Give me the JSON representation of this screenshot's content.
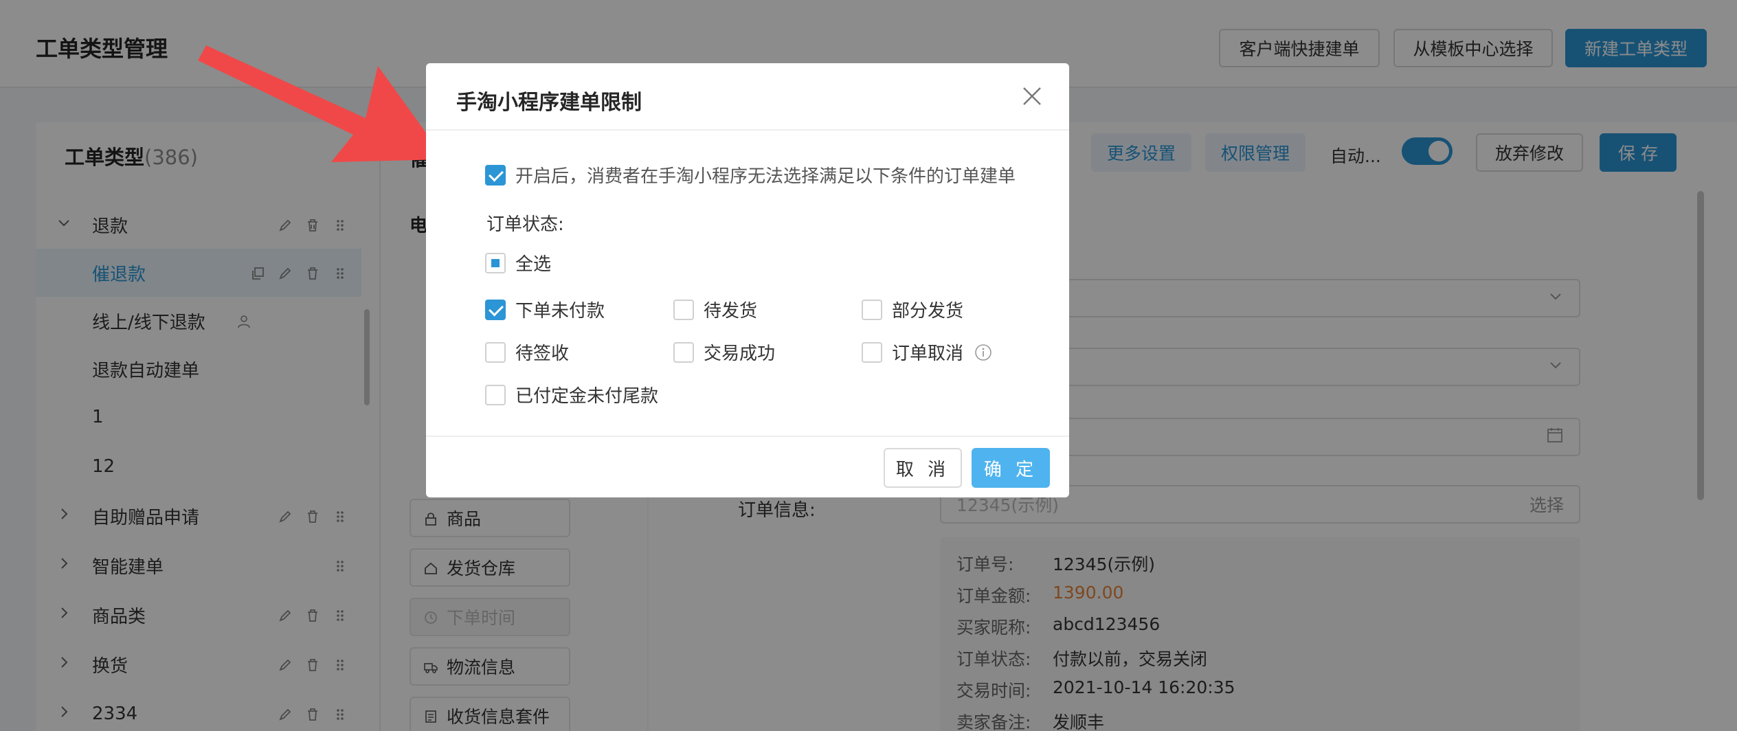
{
  "header": {
    "title": "工单类型管理",
    "buttons": [
      "客户端快捷建单",
      "从模板中心选择",
      "新建工单类型"
    ]
  },
  "sidebar": {
    "title": "工单类型",
    "count": "(386)",
    "items": [
      {
        "label": "退款",
        "expandable": true,
        "expanded": true
      },
      {
        "label": "催退款",
        "active": true
      },
      {
        "label": "线上/线下退款"
      },
      {
        "label": "退款自动建单"
      },
      {
        "label": "1"
      },
      {
        "label": "12"
      },
      {
        "label": "自助赠品申请",
        "expandable": true
      },
      {
        "label": "智能建单",
        "expandable": true
      },
      {
        "label": "商品类",
        "expandable": true
      },
      {
        "label": "换货",
        "expandable": true
      },
      {
        "label": "2334",
        "expandable": true
      }
    ]
  },
  "middle": {
    "title_partial": "催",
    "subtitle_partial": "电",
    "components": [
      {
        "label": "商品",
        "icon": "lock-icon"
      },
      {
        "label": "发货仓库",
        "icon": "home-icon"
      },
      {
        "label": "下单时间",
        "icon": "clock-icon",
        "disabled": true
      },
      {
        "label": "物流信息",
        "icon": "truck-icon"
      },
      {
        "label": "收货信息套件",
        "icon": "doc-icon"
      }
    ]
  },
  "toolbar": {
    "more_settings": "更多设置",
    "permissions": "权限管理",
    "auto_label": "自动...",
    "discard": "放弃修改",
    "save": "保 存"
  },
  "form": {
    "order_info_label": "订单信息:",
    "order_info_placeholder": "12345(示例)",
    "order_info_suffix": "选择",
    "card": [
      {
        "k": "订单号:",
        "v": "12345(示例)"
      },
      {
        "k": "订单金额:",
        "v": "1390.00",
        "highlight": true
      },
      {
        "k": "买家昵称:",
        "v": "abcd123456"
      },
      {
        "k": "订单状态:",
        "v": "付款以前，交易关闭"
      },
      {
        "k": "交易时间:",
        "v": "2021-10-14 16:20:35"
      },
      {
        "k": "卖家备注:",
        "v": "发顺丰"
      }
    ]
  },
  "dialog": {
    "title": "手淘小程序建单限制",
    "enable_text": "开启后，消费者在手淘小程序无法选择满足以下条件的订单建单",
    "status_label": "订单状态:",
    "select_all": "全选",
    "options": [
      {
        "label": "下单未付款",
        "checked": true
      },
      {
        "label": "待发货",
        "checked": false
      },
      {
        "label": "部分发货",
        "checked": false
      },
      {
        "label": "待签收",
        "checked": false
      },
      {
        "label": "交易成功",
        "checked": false
      },
      {
        "label": "订单取消",
        "checked": false,
        "info": true
      },
      {
        "label": "已付定金未付尾款",
        "checked": false
      }
    ],
    "cancel": "取 消",
    "ok": "确 定"
  },
  "colors": {
    "primary": "#2b95d6",
    "ok_button": "#4fb3ef",
    "price": "#e8833a",
    "arrow": "#f04848"
  }
}
